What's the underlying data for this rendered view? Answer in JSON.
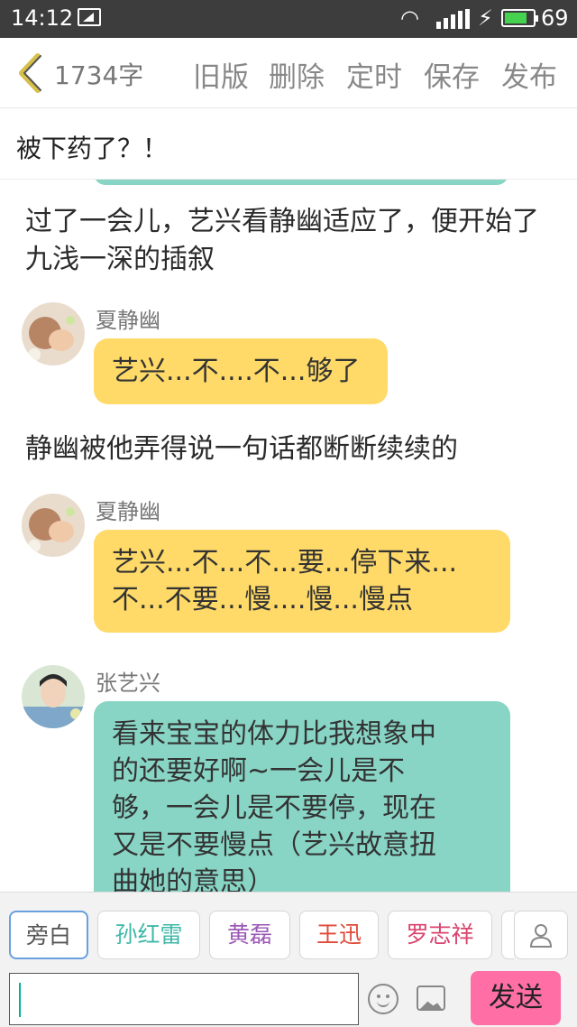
{
  "status_bar": {
    "time": "14:12",
    "battery": "69"
  },
  "toolbar": {
    "word_count": "1734字",
    "actions": [
      "旧版",
      "删除",
      "定时",
      "保存",
      "发布"
    ]
  },
  "title": "被下药了？！",
  "messages": [
    {
      "type": "narration",
      "text": "过了一会儿，艺兴看静幽适应了，便开始了九浅一深的插叙"
    },
    {
      "type": "dialogue",
      "speaker": "夏静幽",
      "color": "yellow",
      "lines": [
        "艺兴...不....不...够了"
      ]
    },
    {
      "type": "narration",
      "text": "静幽被他弄得说一句话都断断续续的"
    },
    {
      "type": "dialogue",
      "speaker": "夏静幽",
      "color": "yellow",
      "lines": [
        "艺兴...不...不...要...停下来...",
        "不...不要...慢....慢...慢点"
      ]
    },
    {
      "type": "dialogue",
      "speaker": "张艺兴",
      "color": "teal",
      "lines": [
        "看来宝宝的体力比我想象中",
        "的还要好啊~一会儿是不",
        "够，一会儿是不要停，现在",
        "又是不要慢点（艺兴故意扭",
        "曲她的意思）"
      ]
    }
  ],
  "characters": [
    {
      "label": "旁白",
      "color": "#555555",
      "active": true
    },
    {
      "label": "孙红雷",
      "color": "#3fb8a8",
      "active": false
    },
    {
      "label": "黄磊",
      "color": "#9b59b6",
      "active": false
    },
    {
      "label": "王迅",
      "color": "#e04a3a",
      "active": false
    },
    {
      "label": "罗志祥",
      "color": "#d9446e",
      "active": false
    }
  ],
  "input": {
    "value": "",
    "send_label": "发送"
  },
  "icons": [
    "back-chevron-icon",
    "add-character-icon",
    "emoji-icon",
    "image-icon",
    "wifi-icon",
    "signal-icon",
    "battery-icon"
  ]
}
